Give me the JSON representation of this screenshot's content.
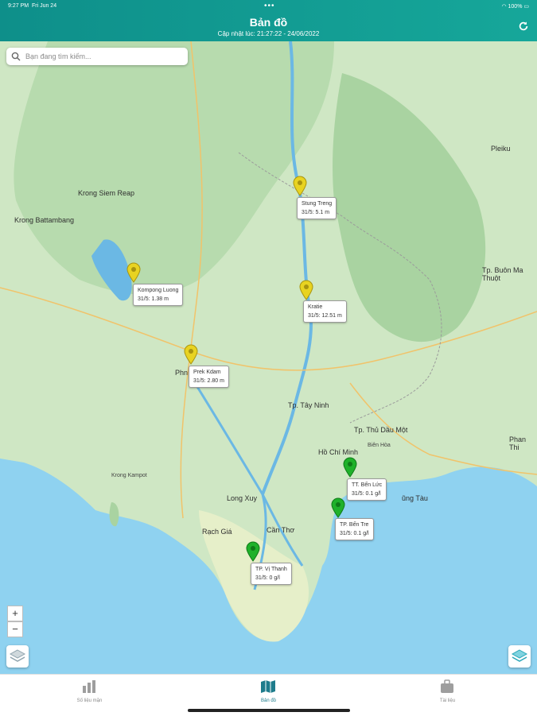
{
  "status_bar": {
    "time": "9:27 PM",
    "date": "Fri Jun 24",
    "battery": "100%",
    "dots": "•••"
  },
  "header": {
    "title": "Bản đồ",
    "subtitle": "Cập nhật lúc: 21:27:22 - 24/06/2022",
    "refresh_icon": "refresh-icon"
  },
  "search": {
    "placeholder": "Bạn đang tìm kiếm..."
  },
  "markers": [
    {
      "name": "Stung Treng",
      "value": "31/5: 5.1 m",
      "status": "yellow"
    },
    {
      "name": "Kompong Luong",
      "value": "31/5: 1.38 m",
      "status": "yellow"
    },
    {
      "name": "Kratie",
      "value": "31/5: 12.51 m",
      "status": "yellow"
    },
    {
      "name": "Prek Kdam",
      "value": "31/5: 2.80 m",
      "status": "yellow"
    },
    {
      "name": "TT. Bến Lức",
      "value": "31/5: 0.1 g/l",
      "status": "green"
    },
    {
      "name": "TP. Bến Tre",
      "value": "31/5: 0.1 g/l",
      "status": "green"
    },
    {
      "name": "TP. Vị Thanh",
      "value": "31/5: 0 g/l",
      "status": "green"
    }
  ],
  "map_labels": {
    "hcm": "Hồ Chí Minh",
    "phnom": "Phn",
    "tay_ninh": "Tp. Tây Ninh",
    "thu_dau_mot": "Tp. Thủ Dầu Một",
    "long_xuyen": "Long Xuy",
    "can_tho": "Cần Thơ",
    "rach_gia": "Rạch Giá",
    "buon_ma_thuot": "Tp. Buôn Ma Thuột",
    "pleiku": "Pleiku",
    "phan_thiet": "Phan Thi",
    "vung_tau": "ũng Tàu",
    "siem_reap": "Krong Siem Reap",
    "battambang": "Krong Battambang",
    "kampot": "Krong Kampot",
    "bien_hoa": "Biên Hòa"
  },
  "zoom": {
    "in": "+",
    "out": "−"
  },
  "colors": {
    "accent": "#1e7c8c",
    "pin_yellow": "#e8d321",
    "pin_green": "#1fb12a",
    "water": "#8fd2f0"
  },
  "tabs": [
    {
      "label": "Số liệu mặn",
      "icon": "bar-chart-icon",
      "active": false
    },
    {
      "label": "Bản đồ",
      "icon": "map-icon",
      "active": true
    },
    {
      "label": "Tài liệu",
      "icon": "briefcase-icon",
      "active": false
    }
  ]
}
